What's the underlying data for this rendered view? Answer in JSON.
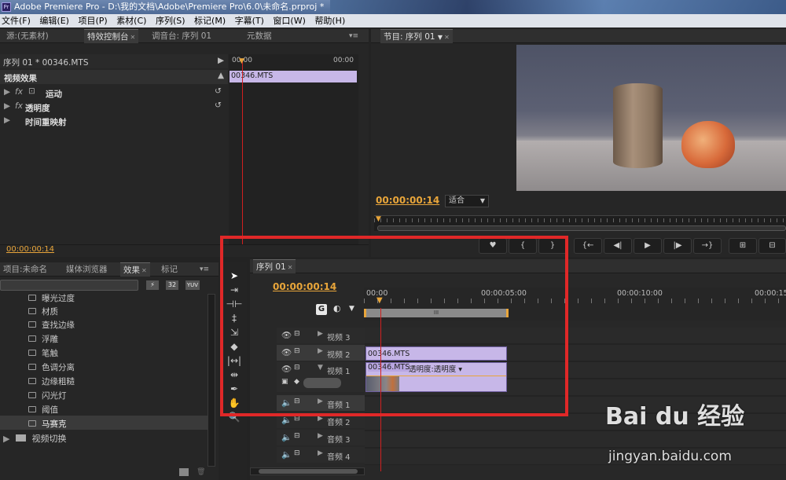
{
  "window": {
    "title": "Adobe Premiere Pro - D:\\我的文档\\Adobe\\Premiere Pro\\6.0\\未命名.prproj *",
    "app_icon": "Pr"
  },
  "menu": [
    "文件(F)",
    "编辑(E)",
    "项目(P)",
    "素材(C)",
    "序列(S)",
    "标记(M)",
    "字幕(T)",
    "窗口(W)",
    "帮助(H)"
  ],
  "source_tabs": {
    "source": "源:(无素材)",
    "effect_controls": "特效控制台",
    "mixer": "调音台: 序列 01",
    "metadata": "元数据"
  },
  "effect_controls": {
    "sequence_label": "序列 01 * 00346.MTS",
    "ruler_start": "00:00",
    "ruler_end": "00:00",
    "section": "视频效果",
    "effects": [
      {
        "label": "运动"
      },
      {
        "label": "透明度"
      },
      {
        "label": "时间重映射"
      }
    ],
    "clip": "00346.MTS",
    "timecode": "00:00:00:14"
  },
  "program": {
    "tab": "节目: 序列 01",
    "timecode": "00:00:00:14",
    "fit": "适合"
  },
  "project_tabs": {
    "project": "项目:未命名",
    "media_browser": "媒体浏览器",
    "effects": "效果",
    "markers": "标记"
  },
  "effects_list": {
    "search_placeholder": "",
    "badges": [
      "32",
      "YUV"
    ],
    "items": [
      "曝光过度",
      "材质",
      "查找边缘",
      "浮雕",
      "笔触",
      "色调分离",
      "边缘粗糙",
      "闪光灯",
      "阈值",
      "马赛克"
    ],
    "selected": "马赛克",
    "folder": "视频切换"
  },
  "timeline": {
    "tab": "序列 01",
    "timecode": "00:00:00:14",
    "ruler": [
      "00:00",
      "00:00:05:00",
      "00:00:10:00",
      "00:00:15:"
    ],
    "video_tracks": [
      "视频 3",
      "视频 2",
      "视频 1"
    ],
    "audio_tracks": [
      "音频 1",
      "音频 2",
      "音频 3",
      "音频 4"
    ],
    "clip_v2": "00346.MTS",
    "clip_v1": "00346.MTS",
    "clip_v1_effect": "透明度:透明度",
    "work_area_mark": "III"
  },
  "watermark": {
    "brand": "Bai du 经验",
    "url": "jingyan.baidu.com"
  },
  "colors": {
    "highlight_box": "#e02828",
    "timecode": "#e8a53a",
    "clip": "#c7b7e8",
    "playhead": "#d02020"
  }
}
